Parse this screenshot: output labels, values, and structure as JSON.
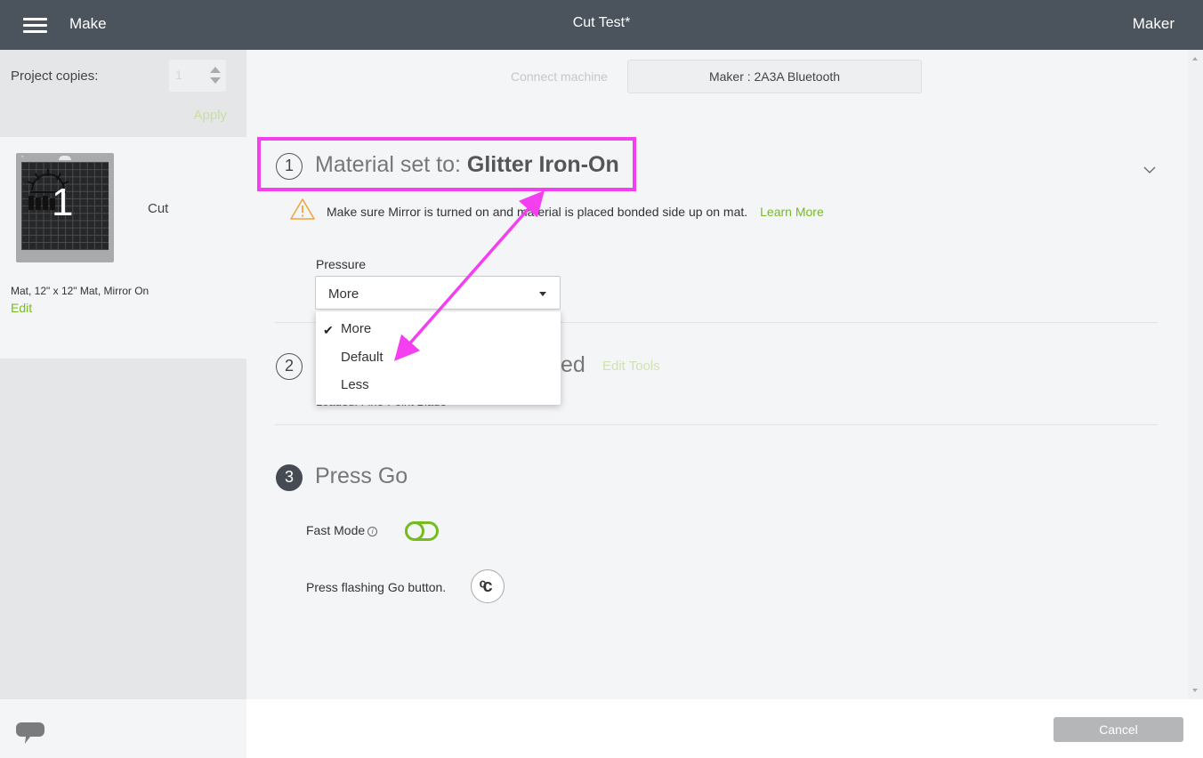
{
  "header": {
    "menu_icon": "hamburger-menu-icon",
    "app_title": "Make",
    "doc_title": "Cut Test*",
    "machine_label": "Maker"
  },
  "sidebar": {
    "copies_label": "Project copies:",
    "copies_value": "1",
    "apply_label": "Apply",
    "mat": {
      "number": "1",
      "action_label": "Cut",
      "description": "Mat, 12\" x 12\" Mat, Mirror On",
      "edit_label": "Edit"
    },
    "chat_icon": "speech-bubble-icon"
  },
  "main": {
    "connect_label": "Connect machine",
    "machine_button": "Maker : 2A3A Bluetooth",
    "step1": {
      "number": "1",
      "title_prefix": "Material set to: ",
      "material": "Glitter Iron-On",
      "warning": "Make sure Mirror is turned on and material is placed bonded side up on mat.",
      "learn_more": "Learn More",
      "pressure_label": "Pressure",
      "pressure_value": "More"
    },
    "step2": {
      "number": "2",
      "title_visible_suffix": "ed",
      "edit_tools": "Edit Tools",
      "loaded_text": "Loaded: Fine-Point Blade"
    },
    "step3": {
      "number": "3",
      "title": "Press Go",
      "fast_mode_label": "Fast Mode",
      "fast_mode_on": false,
      "go_instruction": "Press flashing Go button.",
      "go_icon": "cricut-go-icon"
    },
    "pressure_dropdown": {
      "options": [
        "More",
        "Default",
        "Less"
      ],
      "selected": "More"
    }
  },
  "footer": {
    "cancel_label": "Cancel"
  },
  "annotations": {
    "highlight_color": "#f33ff0",
    "arrow_target": "Default"
  },
  "colors": {
    "header_bg": "#4b545c",
    "accent_green": "#76bc21",
    "sidebar_bg": "#e5e6e8",
    "main_bg": "#f4f5f7"
  }
}
